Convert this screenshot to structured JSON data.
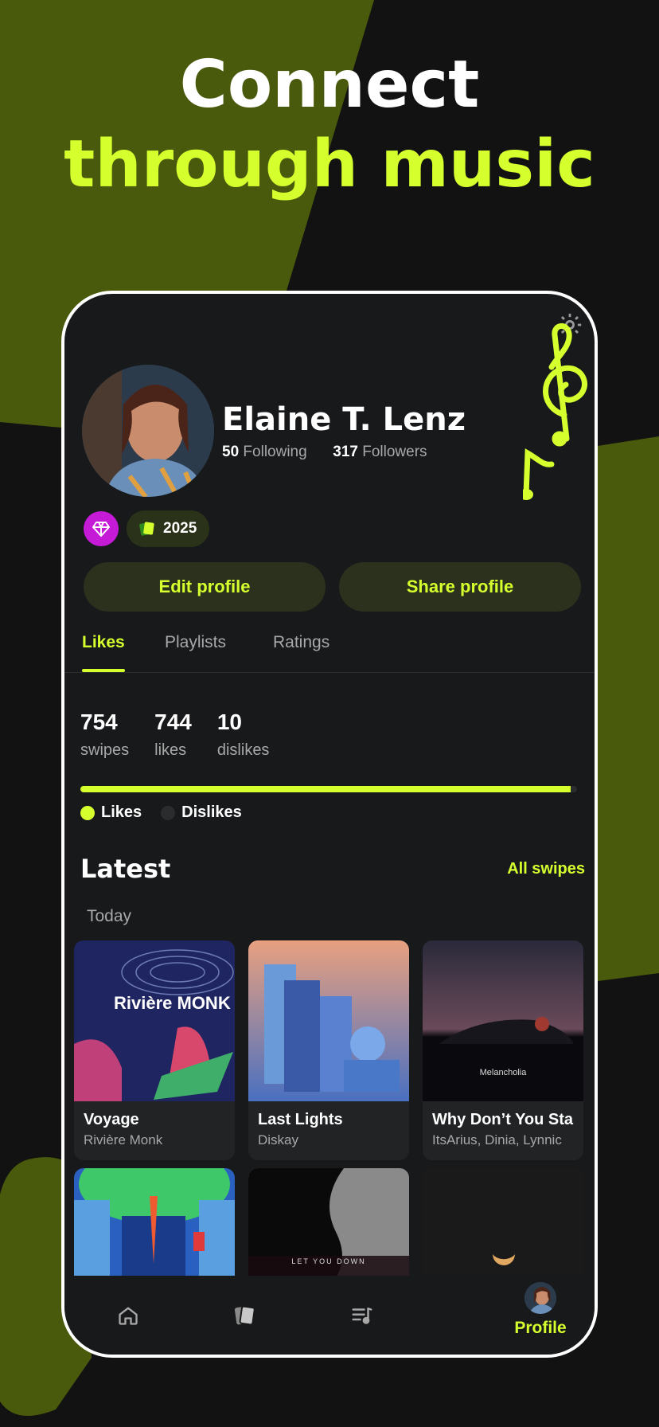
{
  "promo": {
    "line1": "Connect",
    "line2": "through music"
  },
  "colors": {
    "accent": "#d6ff2e",
    "background": "#121212",
    "surface": "#17191b",
    "olive": "#4a5a0c",
    "premium": "#c51ad6"
  },
  "profile": {
    "name": "Elaine T. Lenz",
    "following_count": "50",
    "following_label": "Following",
    "followers_count": "317",
    "followers_label": "Followers",
    "year_badge": "2025"
  },
  "actions": {
    "edit_label": "Edit profile",
    "share_label": "Share profile"
  },
  "tabs": [
    {
      "label": "Likes",
      "active": true
    },
    {
      "label": "Playlists",
      "active": false
    },
    {
      "label": "Ratings",
      "active": false
    }
  ],
  "stats": [
    {
      "value": "754",
      "label": "swipes"
    },
    {
      "value": "744",
      "label": "likes"
    },
    {
      "value": "10",
      "label": "dislikes"
    }
  ],
  "like_ratio": 0.987,
  "legend": {
    "likes": "Likes",
    "dislikes": "Dislikes"
  },
  "latest": {
    "title": "Latest",
    "all_link": "All swipes",
    "group_label": "Today",
    "cards": [
      {
        "title": "Voyage",
        "artist": "Rivière Monk",
        "art_text": "Rivière MONK"
      },
      {
        "title": "Last Lights",
        "artist": "Diskay"
      },
      {
        "title": "Why Don’t You Sta",
        "artist": "ItsArius, Dinia, Lynnic",
        "art_text": "Melancholia"
      }
    ],
    "row2_art_text": "LET YOU DOWN"
  },
  "nav": {
    "profile_label": "Profile",
    "icons": [
      "home-icon",
      "cards-icon",
      "playlist-icon"
    ]
  }
}
